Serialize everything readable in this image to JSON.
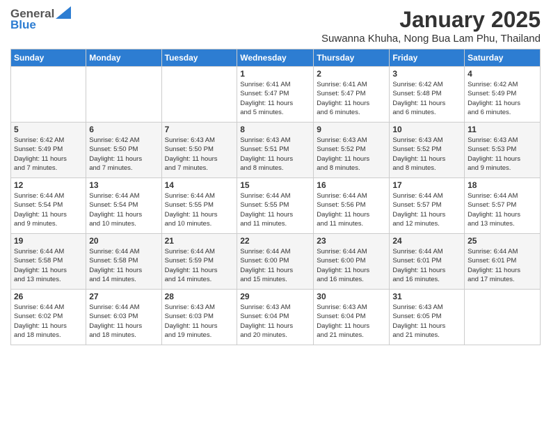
{
  "logo": {
    "general": "General",
    "blue": "Blue"
  },
  "header": {
    "month": "January 2025",
    "location": "Suwanna Khuha, Nong Bua Lam Phu, Thailand"
  },
  "weekdays": [
    "Sunday",
    "Monday",
    "Tuesday",
    "Wednesday",
    "Thursday",
    "Friday",
    "Saturday"
  ],
  "weeks": [
    [
      {
        "day": "",
        "info": ""
      },
      {
        "day": "",
        "info": ""
      },
      {
        "day": "",
        "info": ""
      },
      {
        "day": "1",
        "info": "Sunrise: 6:41 AM\nSunset: 5:47 PM\nDaylight: 11 hours\nand 5 minutes."
      },
      {
        "day": "2",
        "info": "Sunrise: 6:41 AM\nSunset: 5:47 PM\nDaylight: 11 hours\nand 6 minutes."
      },
      {
        "day": "3",
        "info": "Sunrise: 6:42 AM\nSunset: 5:48 PM\nDaylight: 11 hours\nand 6 minutes."
      },
      {
        "day": "4",
        "info": "Sunrise: 6:42 AM\nSunset: 5:49 PM\nDaylight: 11 hours\nand 6 minutes."
      }
    ],
    [
      {
        "day": "5",
        "info": "Sunrise: 6:42 AM\nSunset: 5:49 PM\nDaylight: 11 hours\nand 7 minutes."
      },
      {
        "day": "6",
        "info": "Sunrise: 6:42 AM\nSunset: 5:50 PM\nDaylight: 11 hours\nand 7 minutes."
      },
      {
        "day": "7",
        "info": "Sunrise: 6:43 AM\nSunset: 5:50 PM\nDaylight: 11 hours\nand 7 minutes."
      },
      {
        "day": "8",
        "info": "Sunrise: 6:43 AM\nSunset: 5:51 PM\nDaylight: 11 hours\nand 8 minutes."
      },
      {
        "day": "9",
        "info": "Sunrise: 6:43 AM\nSunset: 5:52 PM\nDaylight: 11 hours\nand 8 minutes."
      },
      {
        "day": "10",
        "info": "Sunrise: 6:43 AM\nSunset: 5:52 PM\nDaylight: 11 hours\nand 8 minutes."
      },
      {
        "day": "11",
        "info": "Sunrise: 6:43 AM\nSunset: 5:53 PM\nDaylight: 11 hours\nand 9 minutes."
      }
    ],
    [
      {
        "day": "12",
        "info": "Sunrise: 6:44 AM\nSunset: 5:54 PM\nDaylight: 11 hours\nand 9 minutes."
      },
      {
        "day": "13",
        "info": "Sunrise: 6:44 AM\nSunset: 5:54 PM\nDaylight: 11 hours\nand 10 minutes."
      },
      {
        "day": "14",
        "info": "Sunrise: 6:44 AM\nSunset: 5:55 PM\nDaylight: 11 hours\nand 10 minutes."
      },
      {
        "day": "15",
        "info": "Sunrise: 6:44 AM\nSunset: 5:55 PM\nDaylight: 11 hours\nand 11 minutes."
      },
      {
        "day": "16",
        "info": "Sunrise: 6:44 AM\nSunset: 5:56 PM\nDaylight: 11 hours\nand 11 minutes."
      },
      {
        "day": "17",
        "info": "Sunrise: 6:44 AM\nSunset: 5:57 PM\nDaylight: 11 hours\nand 12 minutes."
      },
      {
        "day": "18",
        "info": "Sunrise: 6:44 AM\nSunset: 5:57 PM\nDaylight: 11 hours\nand 13 minutes."
      }
    ],
    [
      {
        "day": "19",
        "info": "Sunrise: 6:44 AM\nSunset: 5:58 PM\nDaylight: 11 hours\nand 13 minutes."
      },
      {
        "day": "20",
        "info": "Sunrise: 6:44 AM\nSunset: 5:58 PM\nDaylight: 11 hours\nand 14 minutes."
      },
      {
        "day": "21",
        "info": "Sunrise: 6:44 AM\nSunset: 5:59 PM\nDaylight: 11 hours\nand 14 minutes."
      },
      {
        "day": "22",
        "info": "Sunrise: 6:44 AM\nSunset: 6:00 PM\nDaylight: 11 hours\nand 15 minutes."
      },
      {
        "day": "23",
        "info": "Sunrise: 6:44 AM\nSunset: 6:00 PM\nDaylight: 11 hours\nand 16 minutes."
      },
      {
        "day": "24",
        "info": "Sunrise: 6:44 AM\nSunset: 6:01 PM\nDaylight: 11 hours\nand 16 minutes."
      },
      {
        "day": "25",
        "info": "Sunrise: 6:44 AM\nSunset: 6:01 PM\nDaylight: 11 hours\nand 17 minutes."
      }
    ],
    [
      {
        "day": "26",
        "info": "Sunrise: 6:44 AM\nSunset: 6:02 PM\nDaylight: 11 hours\nand 18 minutes."
      },
      {
        "day": "27",
        "info": "Sunrise: 6:44 AM\nSunset: 6:03 PM\nDaylight: 11 hours\nand 18 minutes."
      },
      {
        "day": "28",
        "info": "Sunrise: 6:43 AM\nSunset: 6:03 PM\nDaylight: 11 hours\nand 19 minutes."
      },
      {
        "day": "29",
        "info": "Sunrise: 6:43 AM\nSunset: 6:04 PM\nDaylight: 11 hours\nand 20 minutes."
      },
      {
        "day": "30",
        "info": "Sunrise: 6:43 AM\nSunset: 6:04 PM\nDaylight: 11 hours\nand 21 minutes."
      },
      {
        "day": "31",
        "info": "Sunrise: 6:43 AM\nSunset: 6:05 PM\nDaylight: 11 hours\nand 21 minutes."
      },
      {
        "day": "",
        "info": ""
      }
    ]
  ]
}
